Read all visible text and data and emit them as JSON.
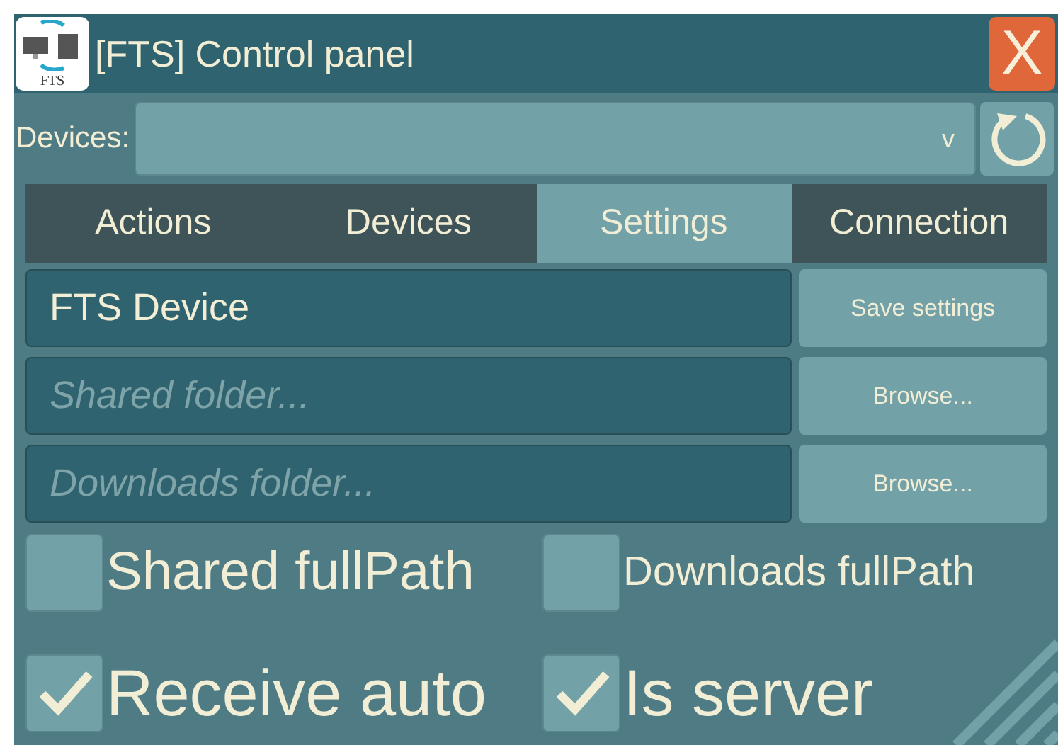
{
  "window": {
    "title": "[FTS] Control panel",
    "logo_text": "FTS",
    "close": "X"
  },
  "devices": {
    "label": "Devices:",
    "chevron": "v"
  },
  "tabs": [
    {
      "label": "Actions",
      "selected": false
    },
    {
      "label": "Devices",
      "selected": false
    },
    {
      "label": "Settings",
      "selected": true
    },
    {
      "label": "Connection",
      "selected": false
    }
  ],
  "fields": [
    {
      "value": "FTS Device",
      "button": "Save settings"
    },
    {
      "placeholder": "Shared folder...",
      "button": "Browse..."
    },
    {
      "placeholder": "Downloads folder...",
      "button": "Browse..."
    }
  ],
  "checkboxes": [
    [
      {
        "label": "Shared fullPath",
        "checked": false
      },
      {
        "label": "Downloads fullPath",
        "checked": false
      }
    ],
    [
      {
        "label": "Receive auto",
        "checked": true
      },
      {
        "label": "Is server",
        "checked": true
      }
    ]
  ]
}
